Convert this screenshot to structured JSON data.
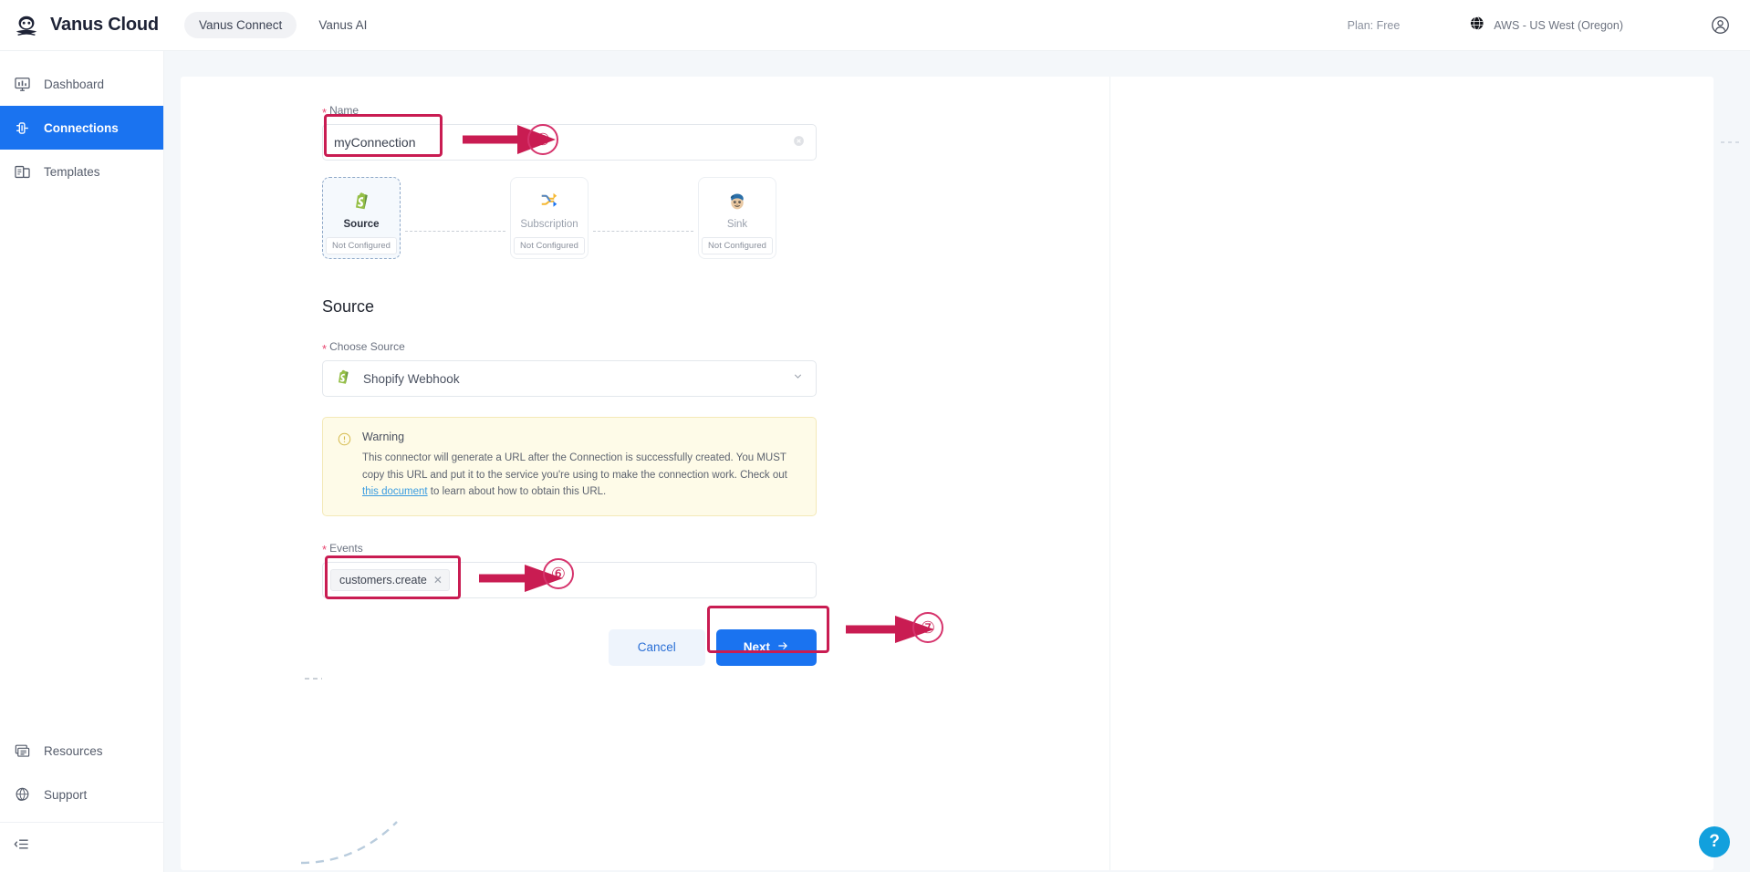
{
  "brand": {
    "name": "Vanus Cloud",
    "logo_icon": "vanus-logo-icon"
  },
  "topnav": {
    "items": [
      {
        "label": "Vanus Connect",
        "active": true
      },
      {
        "label": "Vanus AI",
        "active": false
      }
    ],
    "plan": "Plan: Free",
    "region": "AWS - US West (Oregon)",
    "region_icon": "globe-icon",
    "avatar_icon": "user-circle-icon"
  },
  "sidebar": {
    "items": [
      {
        "label": "Dashboard",
        "icon": "dashboard-icon",
        "active": false
      },
      {
        "label": "Connections",
        "icon": "connections-icon",
        "active": true
      },
      {
        "label": "Templates",
        "icon": "templates-icon",
        "active": false
      }
    ],
    "bottom_items": [
      {
        "label": "Resources",
        "icon": "resources-icon"
      },
      {
        "label": "Support",
        "icon": "support-globe-icon"
      }
    ],
    "collapse_icon": "collapse-sidebar-icon"
  },
  "form": {
    "name_label": "Name",
    "name_value": "myConnection",
    "name_clear_icon": "clear-input-icon",
    "pipeline": [
      {
        "title": "Source",
        "badge": "Not Configured",
        "icon": "shopify-icon",
        "selected": true
      },
      {
        "title": "Subscription",
        "badge": "Not Configured",
        "icon": "subscription-shuffle-icon",
        "selected": false
      },
      {
        "title": "Sink",
        "badge": "Not Configured",
        "icon": "mailchimp-icon",
        "selected": false
      }
    ],
    "section_title": "Source",
    "choose_source_label": "Choose Source",
    "choose_source_value": "Shopify Webhook",
    "choose_source_icon": "shopify-icon",
    "chevron_icon": "chevron-down-icon",
    "warning": {
      "icon": "warning-circle-icon",
      "title": "Warning",
      "text_before": "This connector will generate a URL after the Connection is successfully created. You MUST copy this URL and put it to the service you're using to make the connection work. Check out ",
      "link": "this document",
      "text_after": " to learn about how to obtain this URL."
    },
    "events_label": "Events",
    "events_tags": [
      {
        "label": "customers.create",
        "remove_icon": "remove-tag-icon"
      }
    ],
    "cancel_label": "Cancel",
    "next_label": "Next",
    "next_arrow_icon": "arrow-right-icon"
  },
  "annotations": {
    "step5": "⑤",
    "step6": "⑥",
    "step7": "⑦",
    "accent_color": "#c91c52"
  },
  "help": {
    "label": "?",
    "icon": "help-question-icon"
  },
  "colors": {
    "primary": "#1a73f0",
    "annotation": "#c91c52",
    "warning_bg": "#fefbe8",
    "warning_border": "#f4e9b8",
    "link": "#3a9ce0"
  }
}
